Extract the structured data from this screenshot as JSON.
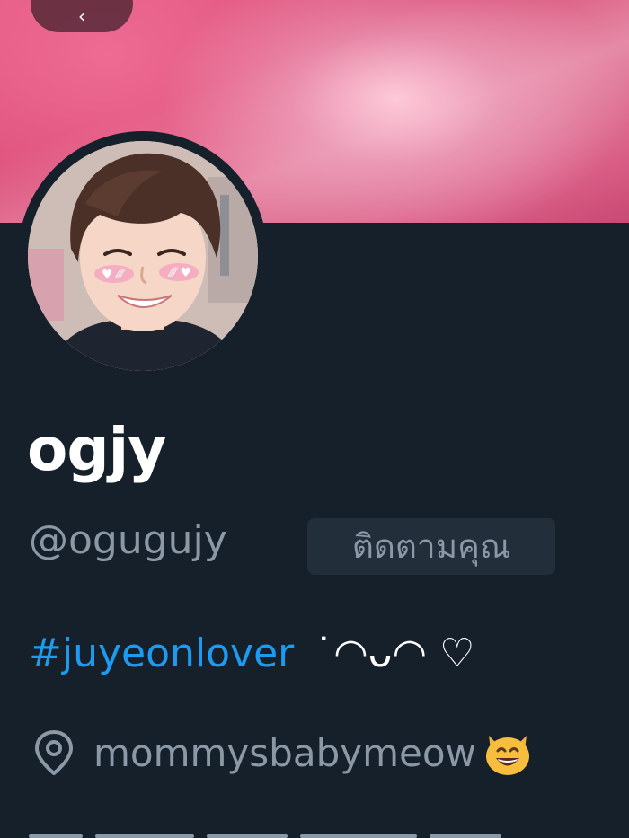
{
  "header": {
    "back_glyph": "‹"
  },
  "profile": {
    "display_name": "ogjy",
    "handle": "@ogugujy",
    "follows_you_badge": "ติดตามคุณ",
    "bio": {
      "hashtag": "#juyeonlover",
      "kaomoji": "˙◠ᴗ◠ ♡"
    },
    "location": {
      "text": "mommysbabymeow",
      "emoji_icon": "grinning-cat-icon"
    }
  },
  "colors": {
    "background": "#15202b",
    "hashtag_blue": "#1d9bf0",
    "secondary_text": "#8b98a5",
    "badge_bg": "#222e3a",
    "banner_pink": "#d84a75"
  }
}
